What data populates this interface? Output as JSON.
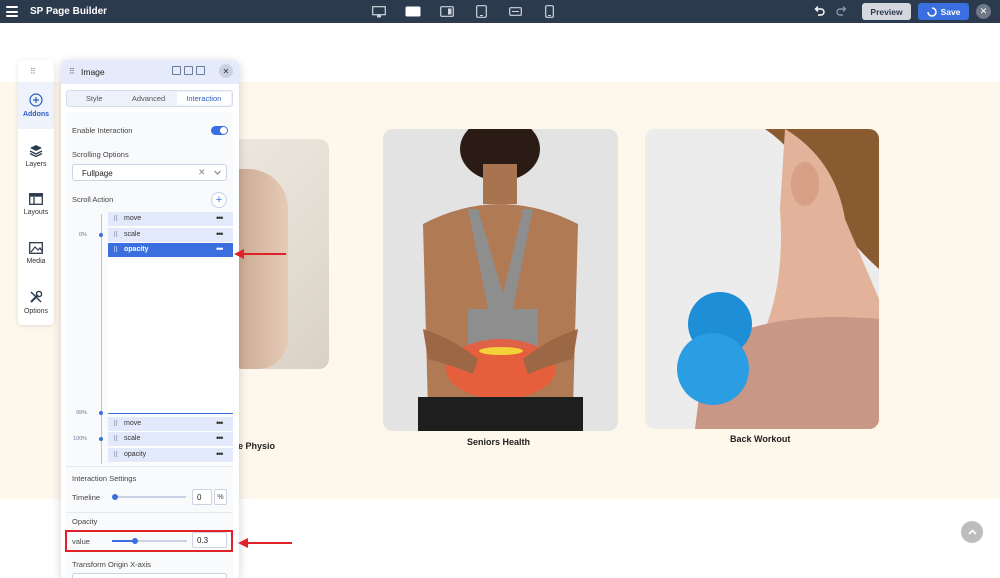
{
  "app": {
    "brand": "SP Page Builder",
    "preview_label": "Preview",
    "save_label": "Save"
  },
  "rail": {
    "items": [
      {
        "label": "Addons",
        "icon": "plus-circle-icon",
        "active": true
      },
      {
        "label": "Layers",
        "icon": "layers-icon"
      },
      {
        "label": "Layouts",
        "icon": "layouts-icon"
      },
      {
        "label": "Media",
        "icon": "media-icon"
      },
      {
        "label": "Options",
        "icon": "tools-icon"
      }
    ]
  },
  "panel": {
    "title": "Image",
    "tabs": [
      "Style",
      "Advanced",
      "Interaction"
    ],
    "active_tab": "Interaction",
    "enable_interaction_label": "Enable Interaction",
    "enable_interaction": true,
    "scrolling_options_label": "Scrolling Options",
    "scrolling_option_value": "Fullpage",
    "scroll_action_label": "Scroll Action",
    "start_actions": [
      {
        "name": "move"
      },
      {
        "name": "scale"
      },
      {
        "name": "opacity",
        "selected": true
      }
    ],
    "end_actions": [
      {
        "name": "move"
      },
      {
        "name": "scale"
      },
      {
        "name": "opacity"
      }
    ],
    "markers": [
      "0%",
      "99%",
      "100%"
    ],
    "interaction_settings_label": "Interaction Settings",
    "timeline_label": "Timeline",
    "timeline_value": "0",
    "timeline_unit": "%",
    "opacity_section_label": "Opacity",
    "opacity_value_label": "value",
    "opacity_value": "0.3",
    "opacity_slider_fraction": 0.3,
    "transform_origin_label": "Transform Origin X-axis"
  },
  "canvas": {
    "captions": [
      "e Physio",
      "Seniors Health",
      "Back Workout"
    ]
  },
  "colors": {
    "topbar": "#2c3a4d",
    "accent": "#3b6fe0",
    "section_bg": "#fdf7ec",
    "highlight": "#e0212a"
  }
}
